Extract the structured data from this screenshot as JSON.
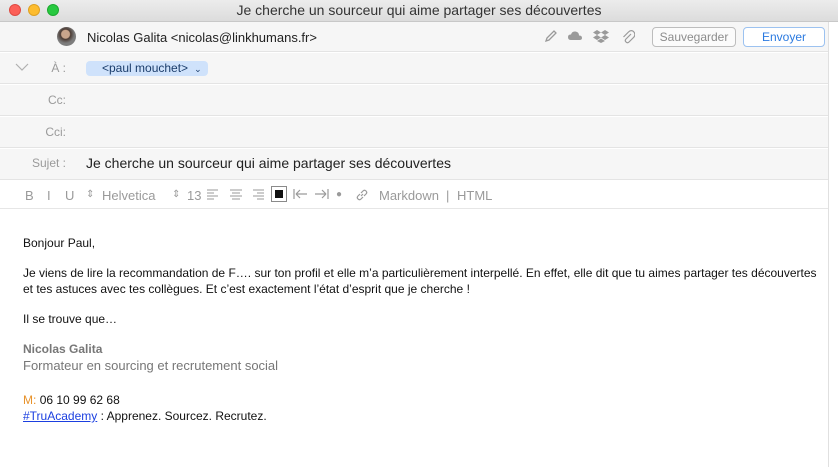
{
  "window": {
    "title": "Je cherche un sourceur qui aime partager ses découvertes"
  },
  "header": {
    "from": "Nicolas Galita <nicolas@linkhumans.fr>",
    "save_label": "Sauvegarder",
    "send_label": "Envoyer"
  },
  "fields": {
    "to_label": "À :",
    "to_recipient": "<paul mouchet>",
    "cc_label": "Cc:",
    "cci_label": "Cci:",
    "subject_label": "Sujet :",
    "subject": "Je cherche un sourceur qui aime partager ses découvertes"
  },
  "toolbar": {
    "bold": "B",
    "italic": "I",
    "underline": "U",
    "font": "Helvetica",
    "size": "13",
    "markdown": "Markdown",
    "separator": "|",
    "html": "HTML"
  },
  "body": {
    "greeting": "Bonjour Paul,",
    "paragraph1": "Je viens de lire la recommandation de F…. sur ton profil et elle m’a particulièrement interpellé. En effet, elle dit que tu aimes partager tes découvertes et tes astuces avec tes collègues. Et c’est exactement l’état d’esprit que je cherche !",
    "paragraph2": "Il se trouve que…"
  },
  "signature": {
    "name": "Nicolas Galita",
    "role": "Formateur en sourcing et recrutement social",
    "phone_label": "M:",
    "phone": "06 10 99 62 68",
    "hashtag": "#TruAcademy",
    "tagline": " : Apprenez. Sourcez. Recrutez."
  },
  "colors": {
    "accent": "#2b7ae0",
    "recipient_pill": "#cfe2fb",
    "phone_label": "#e8922a",
    "link": "#1b3fe0"
  },
  "icons": [
    "pencil-icon",
    "cloud-icon",
    "dropbox-icon",
    "paperclip-icon"
  ]
}
